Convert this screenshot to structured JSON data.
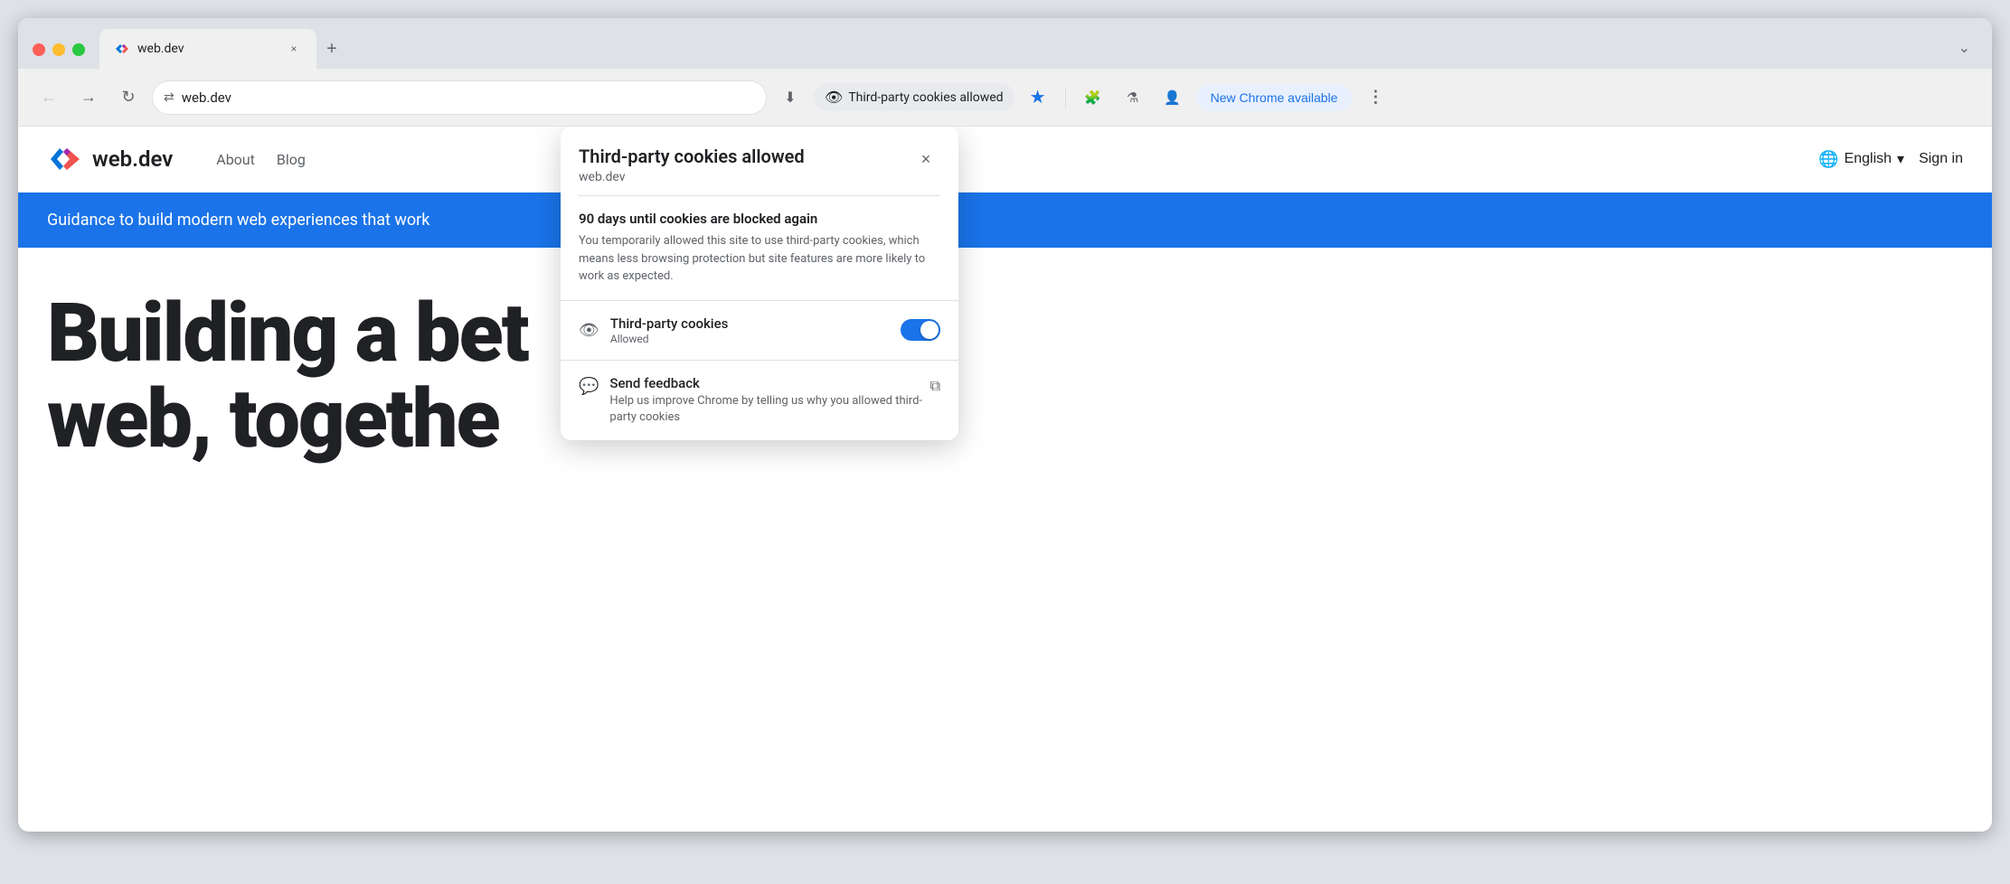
{
  "browser": {
    "tab": {
      "favicon_label": "web.dev favicon",
      "title": "web.dev",
      "close_label": "×",
      "new_tab_label": "+"
    },
    "nav": {
      "back_label": "←",
      "forward_label": "→",
      "reload_label": "↻",
      "address_icon_label": "⇄",
      "address_url": "web.dev",
      "download_icon": "⬇",
      "cookie_badge_icon": "👁",
      "cookie_badge_text": "Third-party cookies allowed",
      "star_icon": "★",
      "extensions_icon": "🧩",
      "lab_icon": "⚗",
      "person_icon": "👤",
      "new_chrome_text": "New Chrome available",
      "more_icon": "⋮"
    },
    "tab_end_chevron": "⌄"
  },
  "website": {
    "logo_text": "web.dev",
    "nav_items": [
      "About",
      "Blog"
    ],
    "lang_text": "English",
    "lang_dropdown": "▾",
    "sign_in_text": "Sign in",
    "banner_text": "Guidance to build modern web experiences that work",
    "hero_line1": "Building a bet",
    "hero_line2": "web, togethe"
  },
  "cookie_popup": {
    "title": "Third-party cookies allowed",
    "subtitle": "web.dev",
    "close_label": "×",
    "info_title": "90 days until cookies are blocked again",
    "info_text": "You temporarily allowed this site to use third-party cookies, which means less browsing protection but site features are more likely to work as expected.",
    "cookies_row": {
      "icon": "👁",
      "label": "Third-party cookies",
      "sublabel": "Allowed",
      "toggle_state": "on"
    },
    "feedback_row": {
      "icon": "💬",
      "label": "Send feedback",
      "description": "Help us improve Chrome by telling us why you allowed third-party cookies",
      "external_icon": "⧉"
    }
  },
  "colors": {
    "accent_blue": "#1a73e8",
    "text_primary": "#202124",
    "text_secondary": "#5f6368",
    "border": "#e0e0e0",
    "background": "#f0f0f0"
  }
}
